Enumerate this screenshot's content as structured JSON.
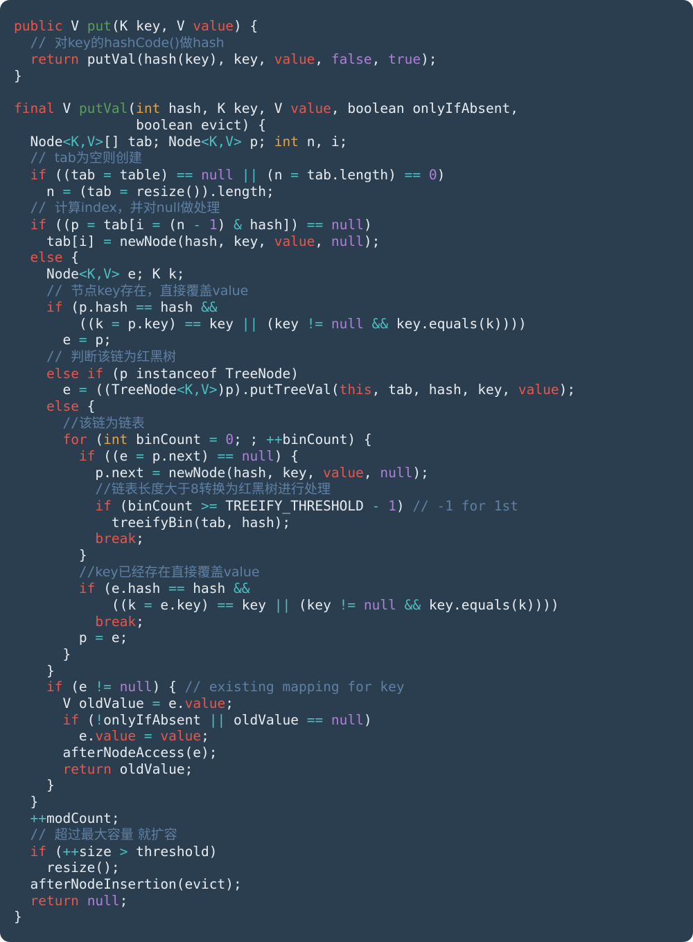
{
  "editor": {
    "kind": "code-screenshot",
    "language": "Java",
    "background_color": "#2b3e50",
    "default_text_color": "#e8ecf0",
    "theme_colors": {
      "keyword": "#e8564a",
      "function_name": "#5a9e5a",
      "primitive_type": "#e8a33d",
      "literal": "#b07fd8",
      "operator": "#4cc0c0",
      "comment": "#5f80a3",
      "plain": "#e8ecf0"
    }
  },
  "code": {
    "lines": [
      "public V put(K key, V value) {",
      "  // 对key的hashCode()做hash",
      "  return putVal(hash(key), key, value, false, true);",
      "}",
      "",
      "final V putVal(int hash, K key, V value, boolean onlyIfAbsent,",
      "               boolean evict) {",
      "  Node<K,V>[] tab; Node<K,V> p; int n, i;",
      "  // tab为空则创建",
      "  if ((tab = table) == null || (n = tab.length) == 0)",
      "    n = (tab = resize()).length;",
      "  // 计算index，并对null做处理",
      "  if ((p = tab[i = (n - 1) & hash]) == null)",
      "    tab[i] = newNode(hash, key, value, null);",
      "  else {",
      "    Node<K,V> e; K k;",
      "    // 节点key存在，直接覆盖value",
      "    if (p.hash == hash &&",
      "        ((k = p.key) == key || (key != null && key.equals(k))))",
      "      e = p;",
      "    // 判断该链为红黑树",
      "    else if (p instanceof TreeNode)",
      "      e = ((TreeNode<K,V>)p).putTreeVal(this, tab, hash, key, value);",
      "    else {",
      "      //该链为链表",
      "      for (int binCount = 0; ; ++binCount) {",
      "        if ((e = p.next) == null) {",
      "          p.next = newNode(hash, key, value, null);",
      "          //链表长度大于8转换为红黑树进行处理",
      "          if (binCount >= TREEIFY_THRESHOLD - 1) // -1 for 1st",
      "            treeifyBin(tab, hash);",
      "          break;",
      "        }",
      "        //key已经存在直接覆盖value",
      "        if (e.hash == hash &&",
      "            ((k = e.key) == key || (key != null && key.equals(k))))",
      "          break;",
      "        p = e;",
      "      }",
      "    }",
      "    if (e != null) { // existing mapping for key",
      "      V oldValue = e.value;",
      "      if (!onlyIfAbsent || oldValue == null)",
      "        e.value = value;",
      "      afterNodeAccess(e);",
      "      return oldValue;",
      "    }",
      "  }",
      "  ++modCount;",
      "  // 超过最大容量 就扩容",
      "  if (++size > threshold)",
      "    resize();",
      "  afterNodeInsertion(evict);",
      "  return null;",
      "}"
    ],
    "comments": [
      "// 对key的hashCode()做hash",
      "// tab为空则创建",
      "// 计算index，并对null做处理",
      "// 节点key存在，直接覆盖value",
      "// 判断该链为红黑树",
      "//该链为链表",
      "//链表长度大于8转换为红黑树进行处理",
      "// -1 for 1st",
      "//key已经存在直接覆盖value",
      "// existing mapping for key",
      "// 超过最大容量 就扩容"
    ],
    "methods": [
      "put",
      "putVal"
    ],
    "identifiers": [
      "hash",
      "key",
      "value",
      "tab",
      "table",
      "resize",
      "newNode",
      "Node",
      "TreeNode",
      "putTreeVal",
      "binCount",
      "TREEIFY_THRESHOLD",
      "treeifyBin",
      "oldValue",
      "onlyIfAbsent",
      "afterNodeAccess",
      "modCount",
      "size",
      "threshold",
      "afterNodeInsertion",
      "evict",
      "equals",
      "length",
      "next"
    ]
  }
}
